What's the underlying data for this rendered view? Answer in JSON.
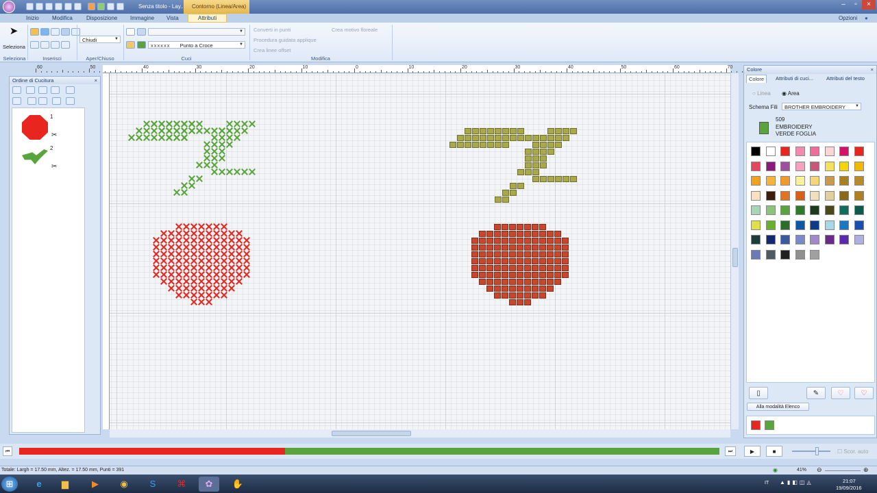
{
  "titlebar": {
    "title": "Senza titolo - Lay...",
    "context_tab": "Contorno (Linea/Area)"
  },
  "tabs": [
    "Inizio",
    "Modifica",
    "Disposizione",
    "Immagine",
    "Vista",
    "Attributi"
  ],
  "options_label": "Opzioni",
  "ribbon": {
    "select_label": "Seleziona",
    "groups": {
      "select": "Seleziona",
      "insert": "Inserisci",
      "open_close": "Aper/Chiuso",
      "sew": "Cuci",
      "modify": "Modifica"
    },
    "close_combo": "Chiudi",
    "stitch_pattern": "xxxxxx",
    "stitch_type": "Punto a Croce",
    "convert_points": "Converti in punti",
    "floral_pattern": "Crea motivo floreale",
    "applique_wizard": "Procedura guidata applique",
    "offset_lines": "Crea linee offset"
  },
  "ruler_labels": [
    "60",
    "50",
    "40",
    "30",
    "20",
    "10",
    "0",
    "10",
    "20",
    "30",
    "40",
    "50",
    "60",
    "70"
  ],
  "sewing_order": {
    "title": "Ordine di Cucitura",
    "items": [
      {
        "num": "1",
        "color": "#e8261f"
      },
      {
        "num": "2",
        "color": "#5aa43e"
      }
    ]
  },
  "color_panel": {
    "title": "Colore",
    "tabs": [
      "Colore",
      "Attributi di cuci...",
      "Attributi del testo"
    ],
    "line_radio": "Linea",
    "area_radio": "Area",
    "thread_chart_label": "Schema Fili",
    "thread_chart": "BROTHER EMBROIDERY",
    "selected_code": "509",
    "selected_brand": "EMBROIDERY",
    "selected_name": "VERDE FOGLIA",
    "selected_color": "#5aa43e",
    "list_mode_button": "Alla modalità Elenco",
    "swatches": [
      "#000000",
      "#ffffff",
      "#e8261f",
      "#f58ab0",
      "#f06c9b",
      "#fcd5d7",
      "#d8106a",
      "#e8261f",
      "#e8465f",
      "#8a1a7c",
      "#a04da0",
      "#f3a3c0",
      "#c7587a",
      "#f3e25c",
      "#f6d400",
      "#f2b800",
      "#f0a21f",
      "#f7b33c",
      "#f29a2e",
      "#fff3a0",
      "#f7d67a",
      "#c79a4c",
      "#a78024",
      "#b88a2a",
      "#fde0c0",
      "#3b1e0c",
      "#e07420",
      "#d95f14",
      "#f0e0bc",
      "#e2cf9c",
      "#8a6a1a",
      "#b08020",
      "#a8d4b8",
      "#8ec47a",
      "#5aa43e",
      "#2e7a2a",
      "#1e3a1e",
      "#4a4a18",
      "#0e6e5a",
      "#0c5a4a",
      "#e0e04a",
      "#6ab02e",
      "#2a6e2a",
      "#0e56a8",
      "#0c3a8a",
      "#a8d8e8",
      "#1878c0",
      "#1850b0",
      "#1c3e3a",
      "#142a6e",
      "#3a5aa0",
      "#7a8ac8",
      "#a08ac8",
      "#6a2a8a",
      "#5a2ab0",
      "#b0b0e0",
      "#6a7ab8",
      "#505a60",
      "#202020",
      "#909090",
      "#a0a0a0"
    ],
    "used_colors": [
      "#e8261f",
      "#5aa43e"
    ]
  },
  "statusbar": {
    "info": "Totale: Largh = 17.50 mm, Altez. = 17.50 mm, Punti = 391",
    "zoom": "41%"
  },
  "playback": {
    "progress_red_fraction": 0.38,
    "speed_label": "Scor. auto"
  },
  "taskbar": {
    "lang": "IT",
    "time": "21:07",
    "date": "19/09/2016"
  },
  "canvas": {
    "cherry_color": "#e8261f",
    "leaf_color": "#5aa43e",
    "preview_leaf": "#a9a94a",
    "preview_cherry": "#c9452c"
  }
}
